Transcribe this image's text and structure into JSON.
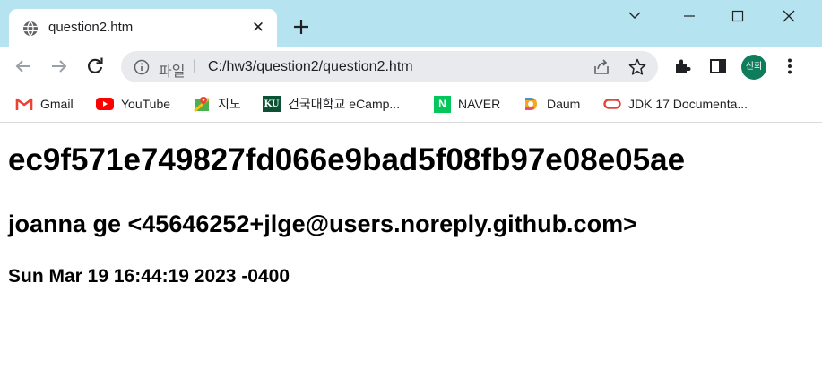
{
  "tab": {
    "title": "question2.htm",
    "close_glyph": "✕",
    "favicon": "globe-icon"
  },
  "window": {
    "controls": [
      "chevron-down-icon",
      "minimize-icon",
      "maximize-icon",
      "close-icon"
    ]
  },
  "omnibox": {
    "prefix": "파일",
    "separator": "|",
    "url": "C:/hw3/question2/question2.htm"
  },
  "profile": {
    "initials": "신회",
    "color": "#0f7c5c"
  },
  "bookmarks": [
    {
      "label": "Gmail",
      "icon": "gmail-icon"
    },
    {
      "label": "YouTube",
      "icon": "youtube-icon"
    },
    {
      "label": "지도",
      "icon": "maps-icon"
    },
    {
      "label": "건국대학교 eCamp...",
      "icon": "ku-icon",
      "icon_text": "KU"
    },
    {
      "label": "NAVER",
      "icon": "naver-icon",
      "icon_text": "N"
    },
    {
      "label": "Daum",
      "icon": "daum-icon"
    },
    {
      "label": "JDK 17 Documenta...",
      "icon": "oracle-icon"
    }
  ],
  "page": {
    "hash": "ec9f571e749827fd066e9bad5f08fb97e08e05ae",
    "author": "joanna ge <45646252+jlge@users.noreply.github.com>",
    "date": "Sun Mar 19 16:44:19 2023 -0400"
  },
  "colors": {
    "tabstrip": "#b5e3f0",
    "omnibox": "#e8eaed",
    "gmail": "#ea4335",
    "youtube": "#ff0000",
    "ku": "#0b5234",
    "naver": "#03c75a",
    "oracle": "#e0463a"
  }
}
